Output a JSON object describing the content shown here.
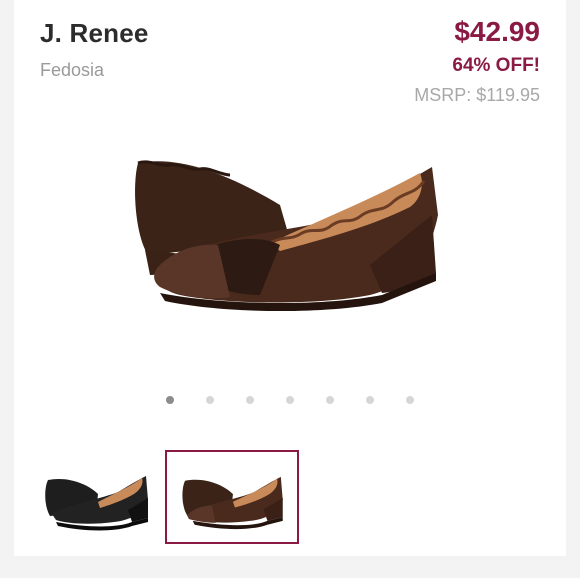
{
  "product": {
    "brand": "J. Renee",
    "model": "Fedosia",
    "price": "$42.99",
    "discount": "64% OFF!",
    "msrp": "MSRP: $119.95"
  },
  "gallery": {
    "dot_count": 7,
    "active_dot": 1,
    "thumbnails": [
      {
        "name": "black-shoe-thumbnail",
        "color": "#1e1e1e",
        "selected": false
      },
      {
        "name": "brown-shoe-thumbnail",
        "color": "#4a2a1c",
        "selected": true
      }
    ]
  },
  "colors": {
    "accent": "#8a1a43",
    "shoe_brown": "#4a2a1c",
    "shoe_black": "#1e1e1e",
    "lining_tan": "#c98a5a"
  }
}
